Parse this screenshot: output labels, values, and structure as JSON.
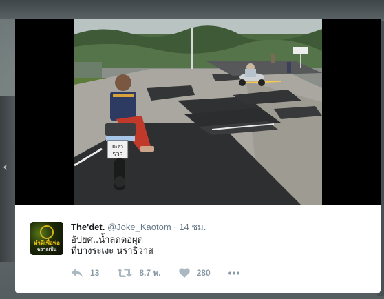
{
  "tweet": {
    "display_name": "The'det.",
    "handle": "@Joke_Kaotom",
    "separator": "·",
    "time": "14 ชม.",
    "text_lines": [
      "อัปยศ..น้ำลดตอผุด",
      "ที่บางระเงะ นราธิวาส"
    ],
    "avatar_text_top": "ทำดีเพื่อพ่อ",
    "avatar_text_bottom": "ฉวากเป็น"
  },
  "photo": {
    "plate_line1": "ยะลา",
    "plate_line2": "533"
  },
  "actions": {
    "reply_count": "13",
    "retweet_count": "8.7 พ.",
    "like_count": "280",
    "more_label": "•••"
  },
  "colors": {
    "icon_gray": "#8899a6",
    "name_black": "#14171a",
    "handle_gray": "#657786"
  },
  "icons": [
    "reply-icon",
    "retweet-icon",
    "heart-icon",
    "more-icon",
    "chevron-left-icon"
  ]
}
